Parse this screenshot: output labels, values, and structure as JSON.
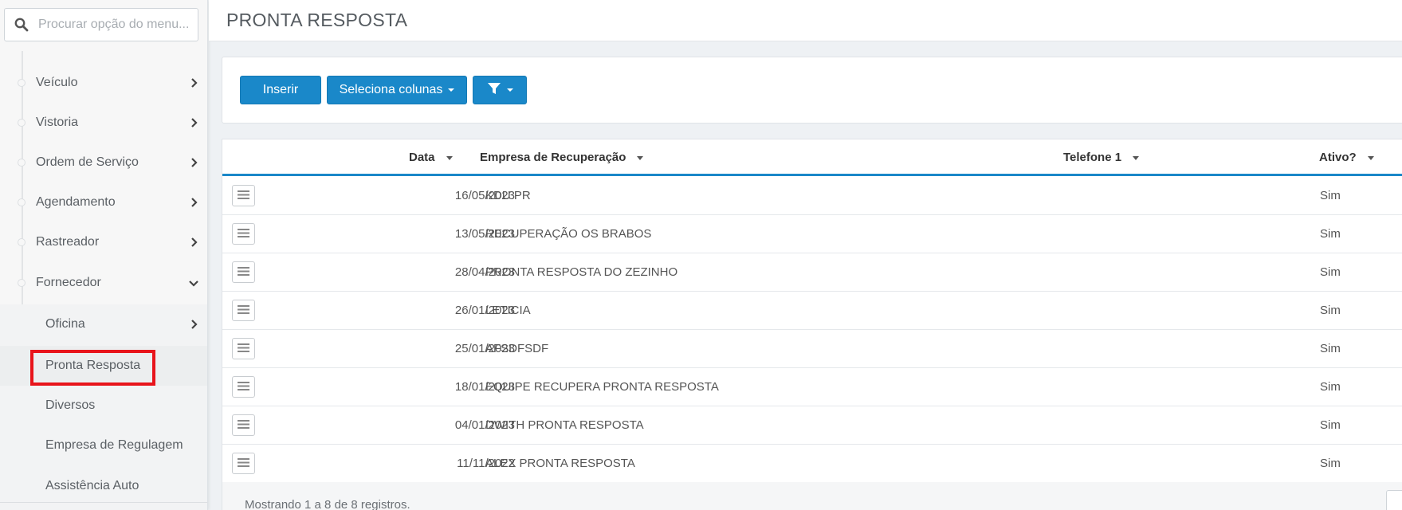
{
  "sidebar": {
    "search": {
      "placeholder": "Procurar opção do menu..."
    },
    "items": [
      {
        "label": "Veículo"
      },
      {
        "label": "Vistoria"
      },
      {
        "label": "Ordem de Serviço"
      },
      {
        "label": "Agendamento"
      },
      {
        "label": "Rastreador"
      },
      {
        "label": "Fornecedor"
      }
    ],
    "sub_items": [
      {
        "label": "Oficina"
      },
      {
        "label": "Pronta Resposta"
      },
      {
        "label": "Diversos"
      },
      {
        "label": "Empresa de Regulagem"
      },
      {
        "label": "Assistência Auto"
      }
    ]
  },
  "header": {
    "title": "PRONTA RESPOSTA"
  },
  "toolbar": {
    "insert_label": "Inserir",
    "columns_label": "Seleciona colunas"
  },
  "table": {
    "columns": [
      "Data",
      "Empresa de Recuperação",
      "Telefone 1",
      "Ativo?"
    ],
    "rows": [
      {
        "data": "16/05/2023",
        "empresa": "KDU PR",
        "telefone": "",
        "ativo": "Sim"
      },
      {
        "data": "13/05/2023",
        "empresa": "RECUPERAÇÃO OS BRABOS",
        "telefone": "",
        "ativo": "Sim"
      },
      {
        "data": "28/04/2023",
        "empresa": "PRONTA RESPOSTA DO ZEZINHO",
        "telefone": "",
        "ativo": "Sim"
      },
      {
        "data": "26/01/2023",
        "empresa": "LETICIA",
        "telefone": "",
        "ativo": "Sim"
      },
      {
        "data": "25/01/2023",
        "empresa": "AFSDFSDF",
        "telefone": "",
        "ativo": "Sim"
      },
      {
        "data": "18/01/2023",
        "empresa": "EQUIPE RECUPERA PRONTA RESPOSTA",
        "telefone": "",
        "ativo": "Sim"
      },
      {
        "data": "04/01/2023",
        "empresa": "DWITH PRONTA RESPOSTA",
        "telefone": "",
        "ativo": "Sim"
      },
      {
        "data": "11/11/2022",
        "empresa": "ALEX PRONTA RESPOSTA",
        "telefone": "",
        "ativo": "Sim"
      }
    ],
    "footer": "Mostrando 1 a 8 de 8 registros."
  },
  "colors": {
    "accent": "#1a88c9",
    "highlight": "#e8141b"
  }
}
